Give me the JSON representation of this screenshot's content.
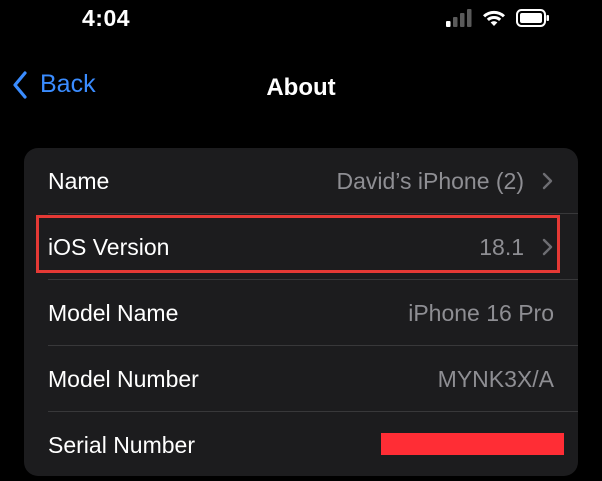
{
  "status_bar": {
    "time": "4:04"
  },
  "nav": {
    "back_label": "Back",
    "title": "About"
  },
  "rows": [
    {
      "label": "Name",
      "value": "David’s iPhone (2)"
    },
    {
      "label": "iOS Version",
      "value": "18.1"
    },
    {
      "label": "Model Name",
      "value": "iPhone 16 Pro"
    },
    {
      "label": "Model Number",
      "value": "MYNK3X/A"
    },
    {
      "label": "Serial Number",
      "value": ""
    }
  ],
  "colors": {
    "accent": "#3a8cff",
    "highlight": "#e53935",
    "redaction": "#ff2d35",
    "card_bg": "#1c1c1e",
    "secondary_text": "#8e8e93"
  },
  "icons": {
    "signal": "cellular-signal-icon",
    "wifi": "wifi-icon",
    "battery": "battery-icon",
    "back": "chevron-left-icon",
    "disclosure": "chevron-right-icon"
  }
}
